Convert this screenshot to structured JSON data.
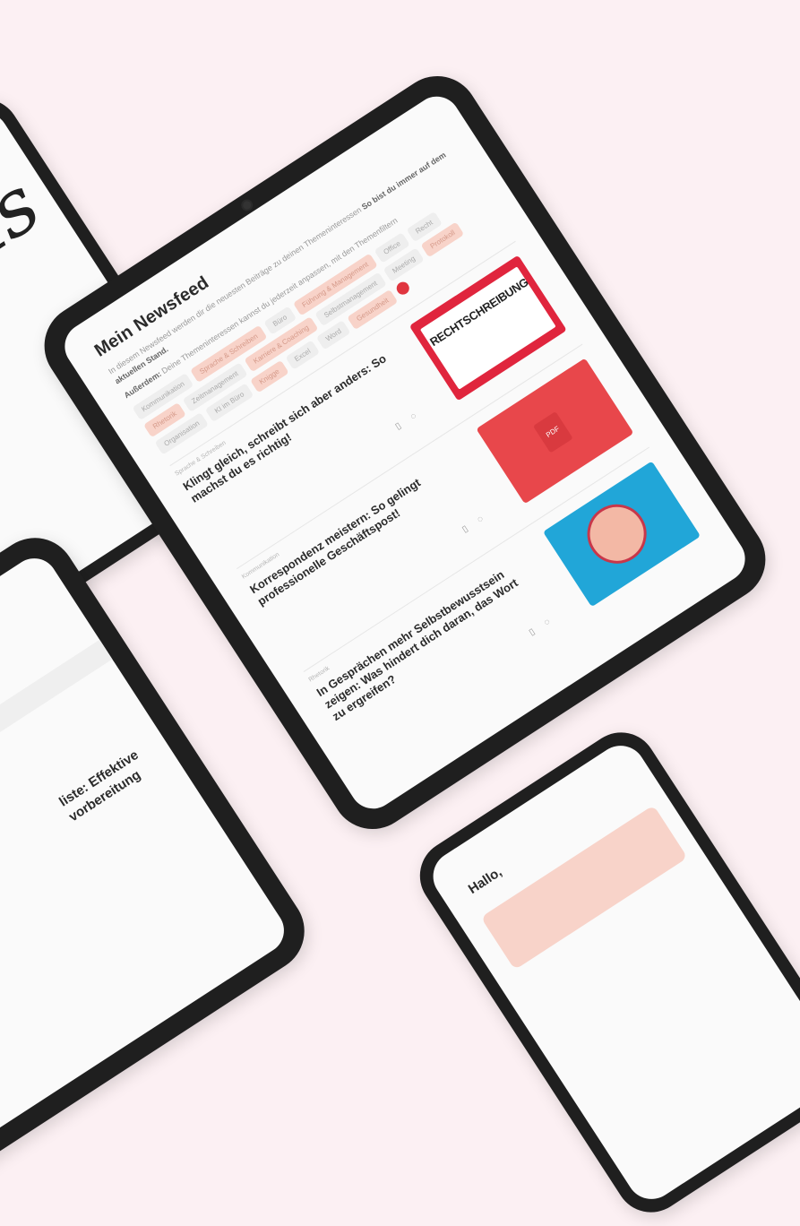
{
  "tablet": {
    "title": "Mein Newsfeed",
    "intro_line1": "In diesem Newsfeed werden dir die neuesten Beiträge zu deinen Themeninteressen",
    "intro_bold": "So bist du immer auf dem aktuellen Stand.",
    "intro_line2_prefix": "Außerdem:",
    "intro_line2": "Deine Themeninteressen kannst du jederzeit anpassen, mit den Themenfiltern",
    "chips": [
      {
        "label": "Kommunikation",
        "highlight": false
      },
      {
        "label": "Sprache & Schreiben",
        "highlight": true
      },
      {
        "label": "Büro",
        "highlight": false
      },
      {
        "label": "Führung & Management",
        "highlight": true
      },
      {
        "label": "Office",
        "highlight": false
      },
      {
        "label": "Recht",
        "highlight": false
      },
      {
        "label": "Rhetorik",
        "highlight": true
      },
      {
        "label": "Zeitmanagement",
        "highlight": false
      },
      {
        "label": "Karriere & Coaching",
        "highlight": true
      },
      {
        "label": "Selbstmanagement",
        "highlight": false
      },
      {
        "label": "Meeting",
        "highlight": false
      },
      {
        "label": "Protokoll",
        "highlight": true
      },
      {
        "label": "Organisation",
        "highlight": false
      },
      {
        "label": "KI im Büro",
        "highlight": false
      },
      {
        "label": "Knigge",
        "highlight": true
      },
      {
        "label": "Excel",
        "highlight": false
      },
      {
        "label": "Word",
        "highlight": false
      },
      {
        "label": "Gesundheit",
        "highlight": true
      }
    ],
    "cards": [
      {
        "title": "Klingt gleich, schreibt sich aber anders: So machst du es richtig!",
        "thumb_text": "RECHTSCHREIBUNG"
      },
      {
        "title": "Korrespondenz meistern: So gelingt professionelle Geschäftspost!",
        "thumb_text": "PDF"
      },
      {
        "title": "In Gesprächen mehr Selbstbewusstsein zeigen: Was hindert dich daran, das Wort zu ergreifen?"
      }
    ]
  },
  "phone_right": {
    "greeting": "Hallo,"
  },
  "tablet_bottom_left": {
    "title_fragment": "liste: Effektive",
    "title_fragment2": "vorbereitung"
  },
  "colors": {
    "background": "#fcf0f3",
    "accent_red": "#e0253d",
    "chip_highlight": "#f8d3c9",
    "device_frame": "#1f1f1f"
  }
}
